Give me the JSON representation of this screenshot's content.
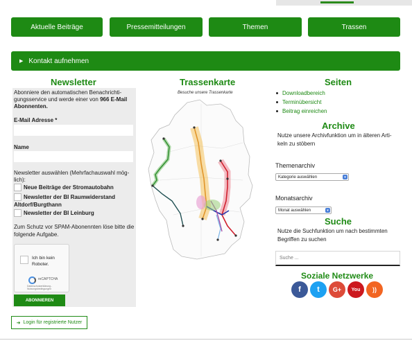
{
  "nav": {
    "items": [
      "Aktuelle Beiträge",
      "Pressemitteilungen",
      "Themen",
      "Trassen"
    ],
    "contact": "Kontakt aufnehmen"
  },
  "newsletter": {
    "title": "Newsletter",
    "intro_1": "Abonniere den automatischen Benachrichti-",
    "intro_2": "gungsservice und werde einer von",
    "intro_count": "966 E-Mail",
    "intro_3": "Abonnenten.",
    "email_label": "E-Mail Adresse *",
    "name_label": "Name",
    "select_label_1": "Newsletter auswählen (Mehrfachauswahl mög-",
    "select_label_2": "lich):",
    "option_1": "Neue Beiträge der Stromautobahn",
    "option_2a": "Newsletter der BI Raumwiderstand",
    "option_2b": "Altdorf/Burgthann",
    "option_3": "Newsletter der BI Leinburg",
    "spam_1": "Zum Schutz vor SPAM-Abonennten löse bitte die",
    "spam_2": "folgende Aufgabe.",
    "captcha_label_1": "Ich bin kein",
    "captcha_label_2": "Roboter.",
    "captcha_brand": "reCAPTCHA",
    "captcha_terms": "Datenschutzerklärung - Nutzungsbedingungen",
    "subscribe": "ABONNIEREN"
  },
  "map": {
    "title": "Trassenkarte",
    "subtitle": "Besuche unsere Trassenkarte"
  },
  "seiten": {
    "title": "Seiten",
    "items": [
      "Downloadbereich",
      "Terminübersicht",
      "Beitrag einreichen"
    ]
  },
  "archive": {
    "title": "Archive",
    "text_1": "Nutze unsere Archivfunktion um in älteren Arti-",
    "text_2": "keln zu stöbern",
    "themen_label": "Themenarchiv",
    "themen_select": "Kategorie auswählen",
    "monat_label": "Monatsarchiv",
    "monat_select": "Monat auswählen"
  },
  "suche": {
    "title": "Suche",
    "text_1": "Nutze die Suchfunktion um nach bestimmten",
    "text_2": "Begriffen zu suchen",
    "placeholder": "Suche ..."
  },
  "social": {
    "title": "Soziale Netzwerke",
    "icons": [
      {
        "name": "facebook-icon",
        "glyph": "f",
        "color": "#3b5998"
      },
      {
        "name": "twitter-icon",
        "glyph": "t",
        "color": "#1da1f2"
      },
      {
        "name": "google-plus-icon",
        "glyph": "G+",
        "color": "#dd4b39"
      },
      {
        "name": "youtube-icon",
        "glyph": "You",
        "color": "#cc181e"
      },
      {
        "name": "rss-icon",
        "glyph": "))",
        "color": "#f26522"
      }
    ]
  },
  "login": "Login für registrierte Nutzer",
  "colors": {
    "brand": "#1e8a14"
  }
}
